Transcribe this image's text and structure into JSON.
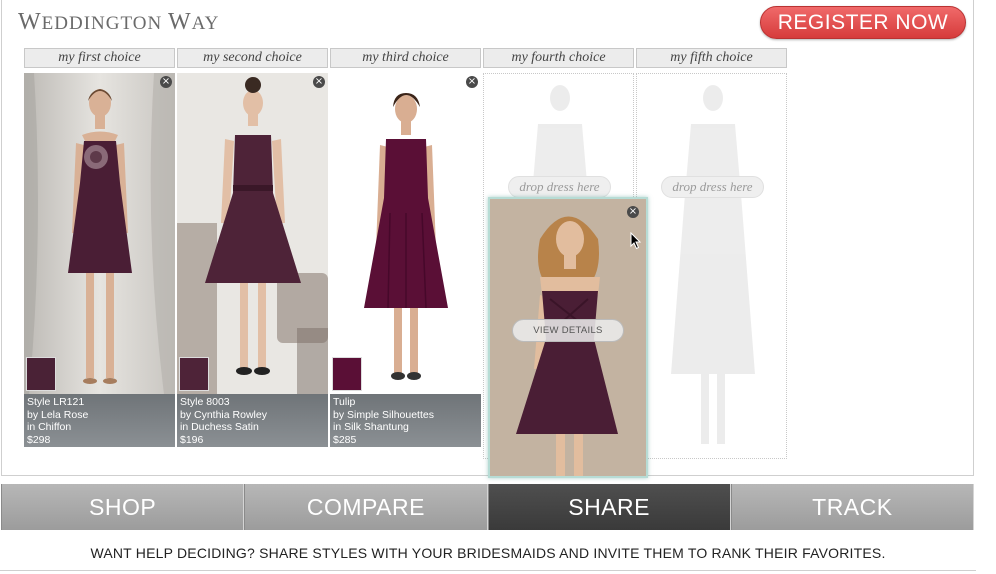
{
  "brand": {
    "logo_part1": "W",
    "logo_part2": "EDDINGTON ",
    "logo_part3": "W",
    "logo_part4": "AY"
  },
  "header": {
    "register_label": "REGISTER NOW"
  },
  "choices": [
    {
      "label": "my first choice"
    },
    {
      "label": "my second choice"
    },
    {
      "label": "my third choice"
    },
    {
      "label": "my fourth choice"
    },
    {
      "label": "my fifth choice"
    }
  ],
  "dresses": [
    {
      "style": "Style LR121",
      "designer": "by Lela Rose",
      "fabric": "in Chiffon",
      "price": "$298",
      "swatch_color": "#4a2236"
    },
    {
      "style": "Style 8003",
      "designer": "by Cynthia Rowley",
      "fabric": "in Duchess Satin",
      "price": "$196",
      "swatch_color": "#4e2338"
    },
    {
      "style": "Tulip",
      "designer": "by Simple Silhouettes",
      "fabric": "in Silk Shantung",
      "price": "$285",
      "swatch_color": "#5a0f36"
    }
  ],
  "drop_placeholder": "drop dress here",
  "dragged_card": {
    "view_details_label": "VIEW DETAILS"
  },
  "close_glyph": "×",
  "nav": {
    "tabs": [
      "SHOP",
      "COMPARE",
      "SHARE",
      "TRACK"
    ],
    "active": "SHARE"
  },
  "tagline": "WANT HELP DECIDING? SHARE STYLES WITH YOUR BRIDESMAIDS AND INVITE THEM TO RANK THEIR FAVORITES.",
  "colors": {
    "accent": "#e04848",
    "dress": "#4a1e35",
    "nav_active": "#444444",
    "nav_inactive": "#a8a8a8"
  },
  "icons": {
    "close": "close-icon",
    "cursor": "mouse-cursor-icon"
  }
}
